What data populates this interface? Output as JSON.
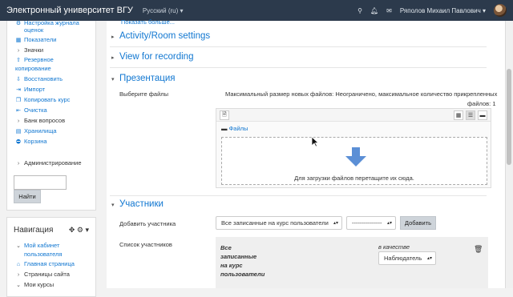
{
  "topbar": {
    "title": "Электронный университет ВГУ",
    "language": "Русский (ru) ▾",
    "user_name": "Ряполов Михаил Павлович ▾",
    "icons": [
      "search-icon",
      "bell-icon",
      "chat-icon"
    ]
  },
  "sidebar": {
    "items": [
      {
        "label": "Настройка журнала",
        "icon": "settings-icon"
      },
      {
        "label": "оценок",
        "icon": ""
      },
      {
        "label": "Показатели",
        "icon": "table-icon"
      },
      {
        "label": "Значки",
        "icon": "chevron-right-icon"
      },
      {
        "label": "Резервное",
        "icon": "upload-icon"
      },
      {
        "label": "копирование",
        "icon": ""
      },
      {
        "label": "Восстановить",
        "icon": "download-icon"
      },
      {
        "label": "Импорт",
        "icon": "import-icon"
      },
      {
        "label": "Копировать курс",
        "icon": "copy-icon"
      },
      {
        "label": "Очистка",
        "icon": "reset-icon"
      },
      {
        "label": "Банк вопросов",
        "icon": "chevron-right-icon"
      },
      {
        "label": "Хранилища",
        "icon": "storage-icon"
      },
      {
        "label": "Корзина",
        "icon": "trash-icon"
      }
    ],
    "admin_label": "Администрирование",
    "search_button": "Найти"
  },
  "navigation": {
    "title": "Навигация",
    "items": [
      {
        "label": "Мой кабинет",
        "icon": "chevron-down-icon"
      },
      {
        "label": "пользователя",
        "icon": ""
      },
      {
        "label": "Главная страница",
        "icon": "home-icon"
      },
      {
        "label": "Страницы сайта",
        "icon": "chevron-right-icon"
      },
      {
        "label": "Мои курсы",
        "icon": "chevron-down-icon"
      }
    ]
  },
  "main": {
    "show_more": "Показать больше...",
    "sections": {
      "activity": "Activity/Room settings",
      "recording": "View for recording",
      "presentation": "Презентация",
      "participants": "Участники"
    },
    "choose_files_label": "Выберите файлы",
    "file_limits_line1": "Максимальный размер новых файлов: Неограничено, максимальное количество прикрепленных",
    "file_limits_line2": "файлов: 1",
    "files_folder": "Файлы",
    "drop_text": "Для загрузки файлов перетащите их сюда.",
    "add_participant_label": "Добавить участника",
    "participant_select": "Все записанные на курс пользователи",
    "role_select": "---------------",
    "add_button": "Добавить",
    "participant_list_label": "Список участников",
    "participant_entry": [
      "Все",
      "записанные",
      "на курс",
      "пользователи"
    ],
    "as_role_label": "в качестве",
    "role_value": "Наблюдатель"
  },
  "colors": {
    "topbar": "#2c3a4c",
    "link": "#1177d1",
    "drop_arrow": "#5b8fd6"
  }
}
